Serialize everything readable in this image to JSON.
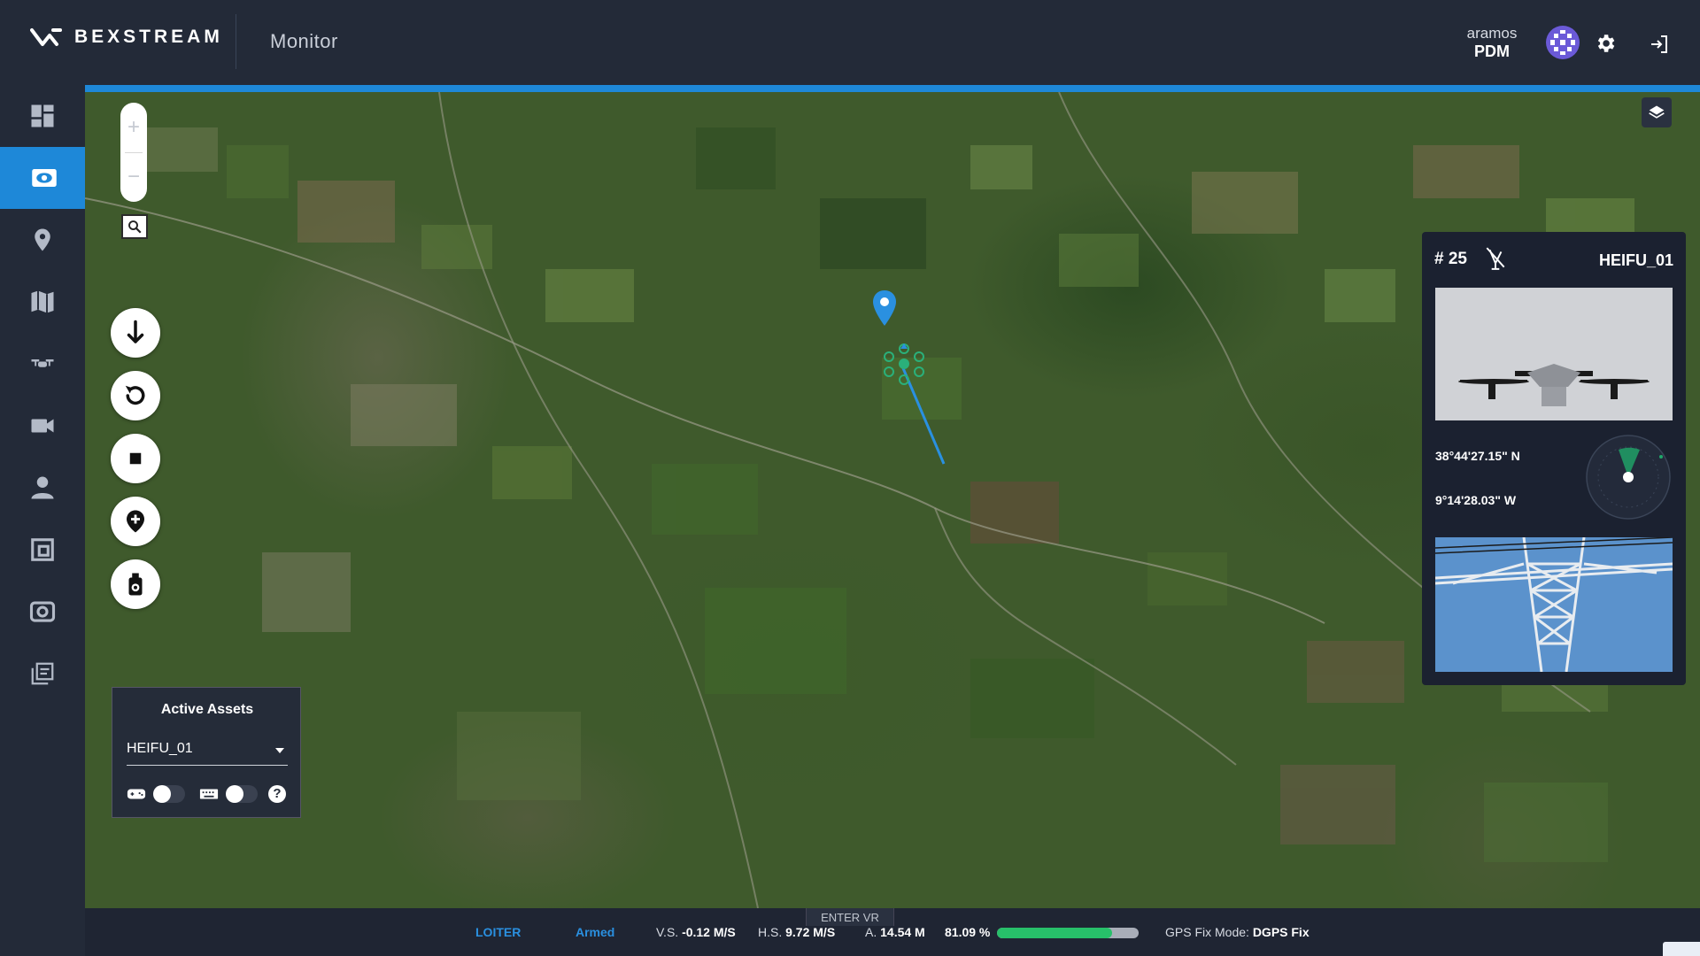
{
  "app": {
    "brand": "BEXSTREAM",
    "page_title": "Monitor"
  },
  "user": {
    "name": "aramos",
    "role": "PDM"
  },
  "sidebar": {
    "items": [
      {
        "icon": "dashboard-icon"
      },
      {
        "icon": "eye-icon",
        "active": true
      },
      {
        "icon": "location-pin-icon"
      },
      {
        "icon": "map-icon"
      },
      {
        "icon": "drone-icon"
      },
      {
        "icon": "video-camera-icon"
      },
      {
        "icon": "user-icon"
      },
      {
        "icon": "media-library-icon"
      },
      {
        "icon": "camera-icon"
      },
      {
        "icon": "missions-icon"
      }
    ]
  },
  "map_controls": {
    "zoom_in": "+",
    "zoom_out": "−",
    "actions": [
      "land-icon",
      "return-home-icon",
      "stop-icon",
      "add-waypoint-icon",
      "camera-capture-icon"
    ]
  },
  "active_assets": {
    "title": "Active Assets",
    "selected": "HEIFU_01",
    "help": "?"
  },
  "drone_panel": {
    "id": "# 25",
    "name": "HEIFU_01",
    "latitude": "38°44'27.15\" N",
    "longitude": "9°14'28.03\" W"
  },
  "status": {
    "vr_label": "ENTER VR",
    "mode": "LOITER",
    "armed": "Armed",
    "vs_label": "V.S.",
    "vs_value": "-0.12 M/S",
    "hs_label": "H.S.",
    "hs_value": "9.72 M/S",
    "alt_label": "A.",
    "alt_value": "14.54 M",
    "battery": "81.09 %",
    "battery_level": 0.81,
    "gps_label": "GPS Fix Mode:",
    "gps_value": "DGPS Fix"
  },
  "colors": {
    "accent": "#1e88d8",
    "battery": "#27c06a",
    "panel": "#1b2130"
  }
}
